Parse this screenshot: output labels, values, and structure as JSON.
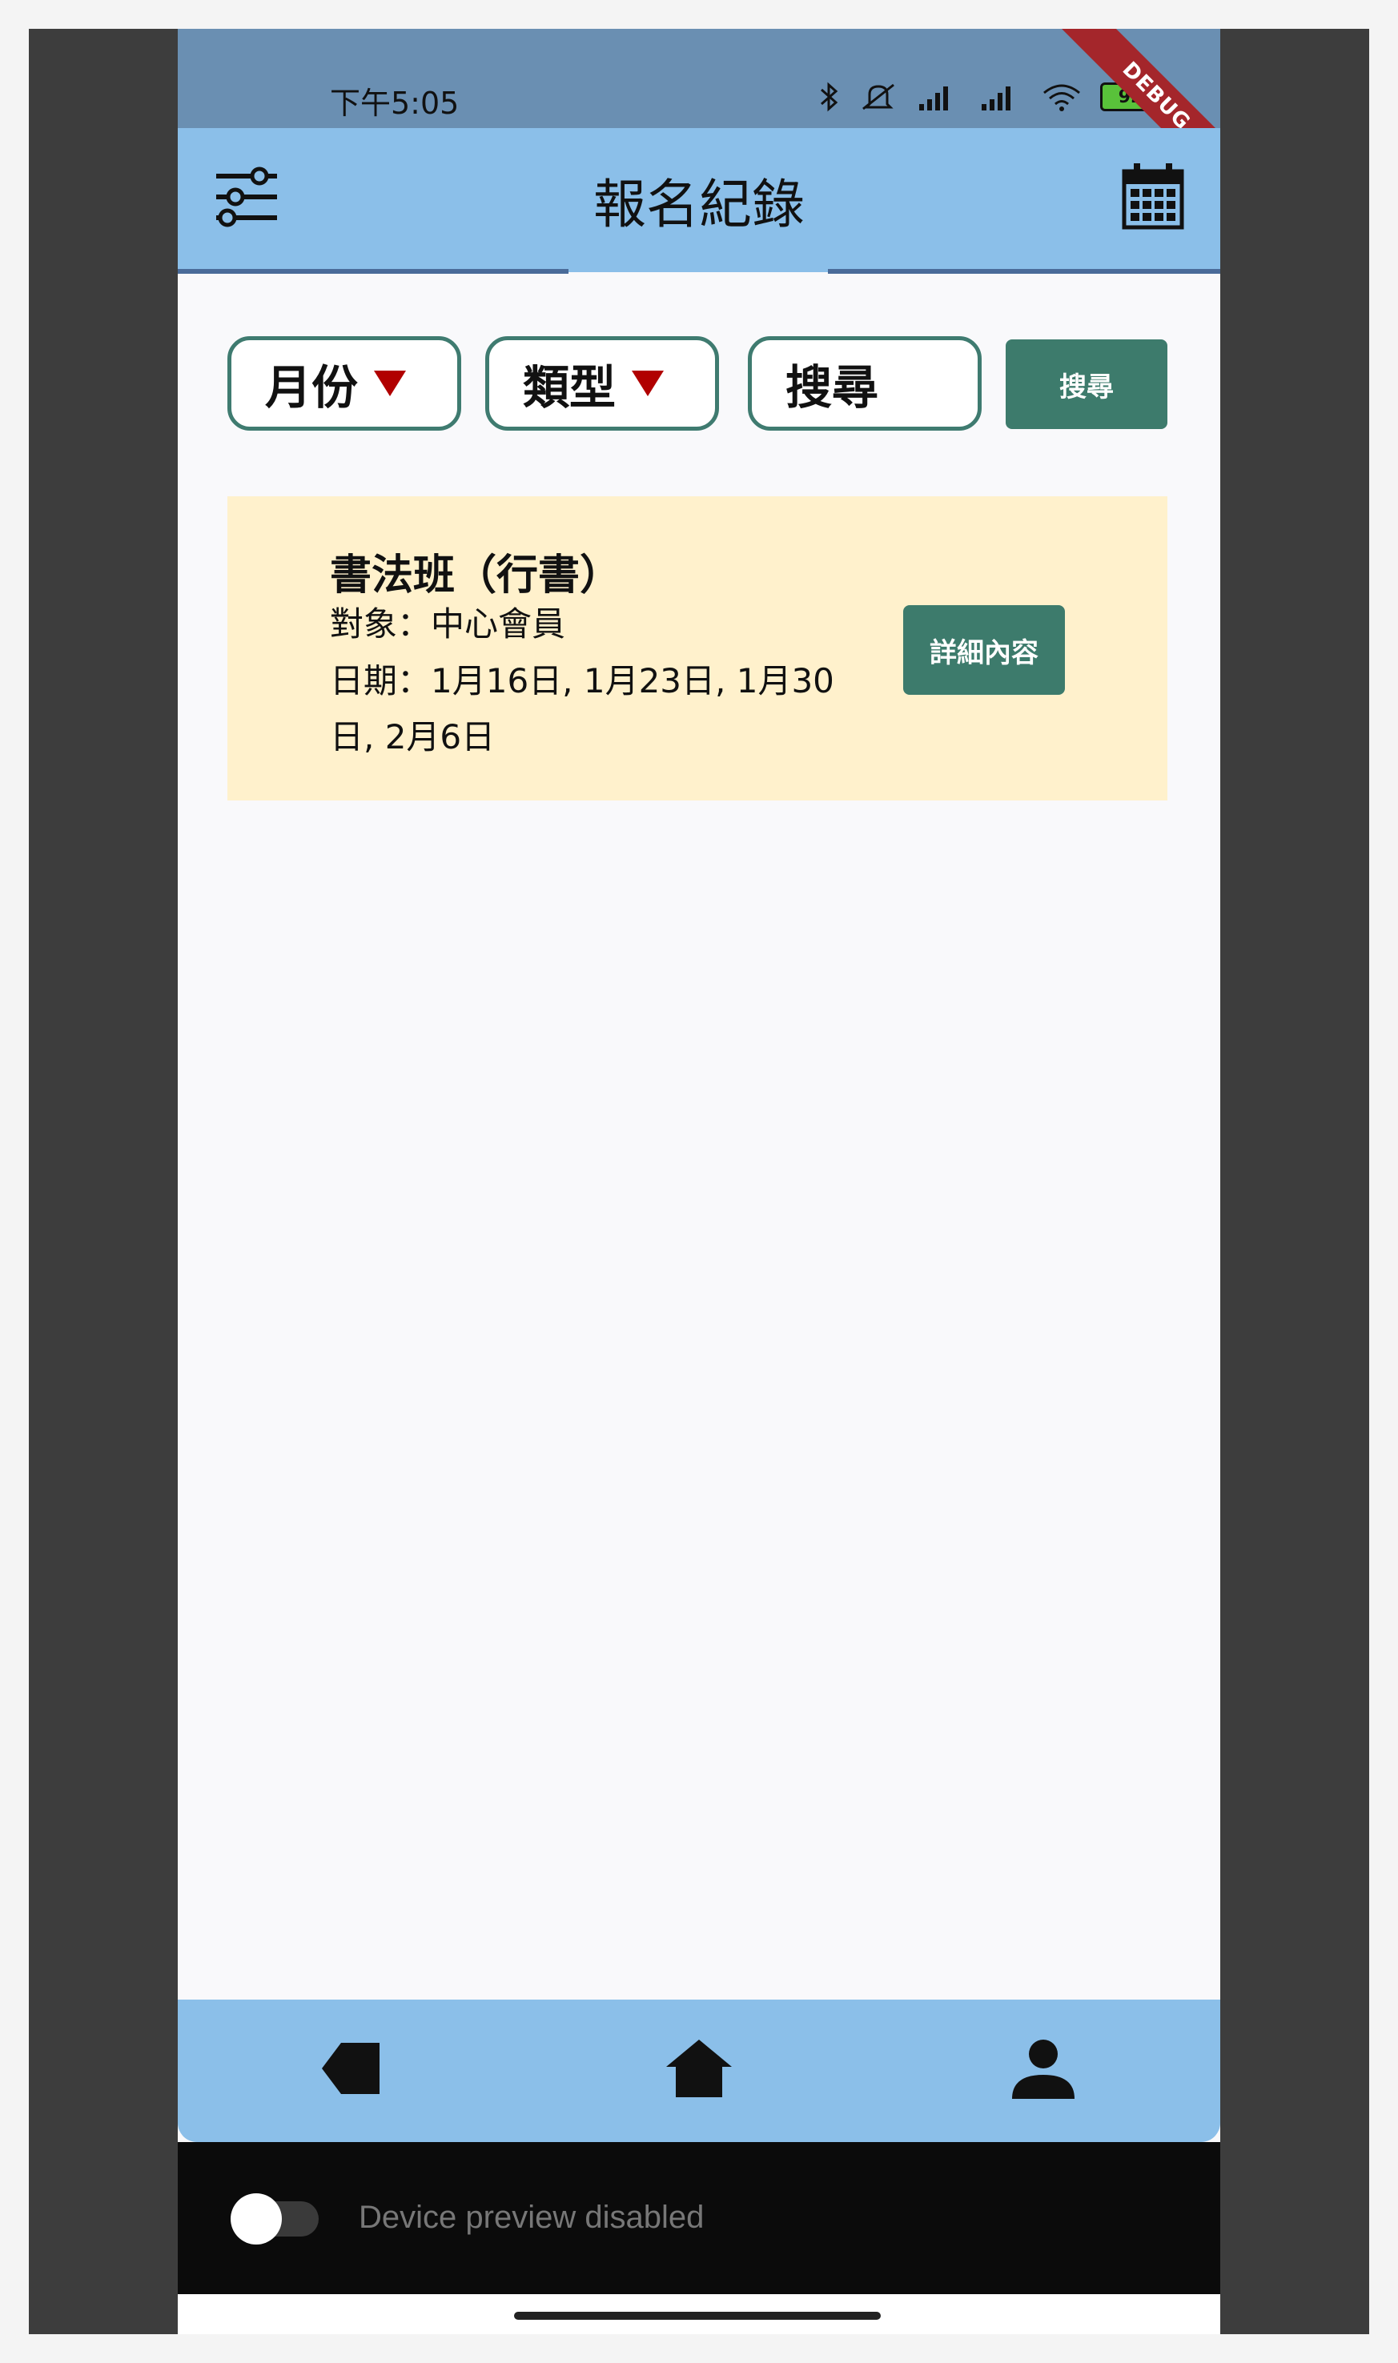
{
  "status_bar": {
    "time": "下午5:05",
    "battery": "92",
    "debug_banner": "DEBUG"
  },
  "app_bar": {
    "title": "報名紀錄",
    "menu_icon": "sliders-icon",
    "calendar_icon": "calendar-icon",
    "color": "#8bbfe9"
  },
  "filters": {
    "month_label": "月份",
    "type_label": "類型",
    "search_placeholder": "搜尋",
    "search_button": "搜尋"
  },
  "records": [
    {
      "title": "書法班（行書）",
      "target": "對象：中心會員",
      "dates_line1": "日期：1月16日, 1月23日, 1月30",
      "dates_line2": "日, 2月6日",
      "detail_button": "詳細內容"
    }
  ],
  "bottom_nav": {
    "items": [
      "back-icon",
      "home-icon",
      "profile-icon"
    ]
  },
  "device_preview": {
    "label": "Device preview disabled"
  },
  "colors": {
    "accent_green": "#3d7b6c",
    "card_bg": "#fff1cc",
    "dropdown_arrow": "#b10000"
  }
}
